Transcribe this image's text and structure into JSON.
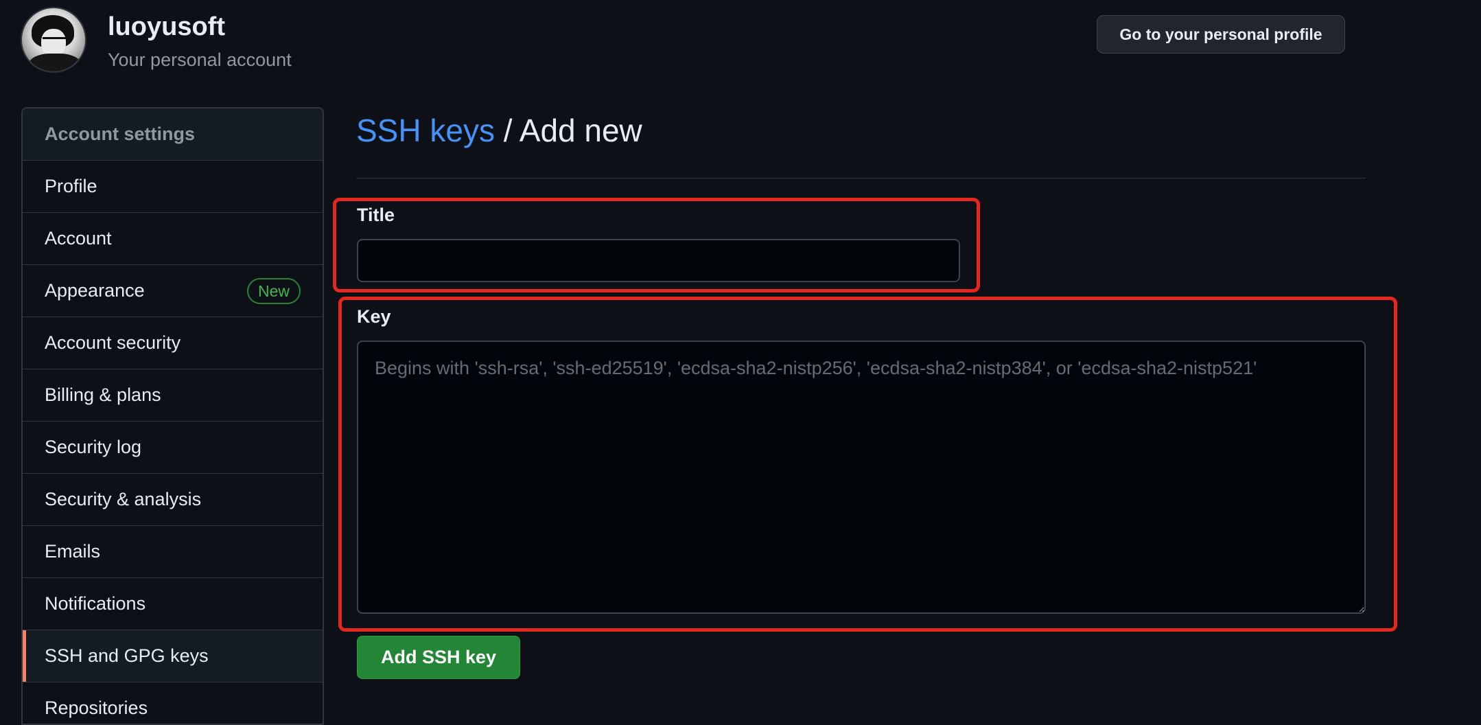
{
  "header": {
    "username": "luoyusoft",
    "subtitle": "Your personal account",
    "profile_button": "Go to your personal profile"
  },
  "sidebar": {
    "heading": "Account settings",
    "items": [
      {
        "label": "Profile"
      },
      {
        "label": "Account"
      },
      {
        "label": "Appearance",
        "badge": "New"
      },
      {
        "label": "Account security"
      },
      {
        "label": "Billing & plans"
      },
      {
        "label": "Security log"
      },
      {
        "label": "Security & analysis"
      },
      {
        "label": "Emails"
      },
      {
        "label": "Notifications"
      },
      {
        "label": "SSH and GPG keys",
        "active": true
      },
      {
        "label": "Repositories"
      }
    ]
  },
  "main": {
    "breadcrumb_link": "SSH keys",
    "breadcrumb_separator": " / ",
    "breadcrumb_current": "Add new",
    "title_label": "Title",
    "title_value": "",
    "key_label": "Key",
    "key_value": "",
    "key_placeholder": "Begins with 'ssh-rsa', 'ssh-ed25519', 'ecdsa-sha2-nistp256', 'ecdsa-sha2-nistp384', or 'ecdsa-sha2-nistp521'",
    "submit_label": "Add SSH key"
  },
  "colors": {
    "background": "#0d1117",
    "accent_link": "#4493f8",
    "primary_button": "#238636",
    "active_indicator": "#f78166",
    "highlight_box": "#e5281f"
  },
  "icons": {
    "avatar": "avatar-image"
  }
}
